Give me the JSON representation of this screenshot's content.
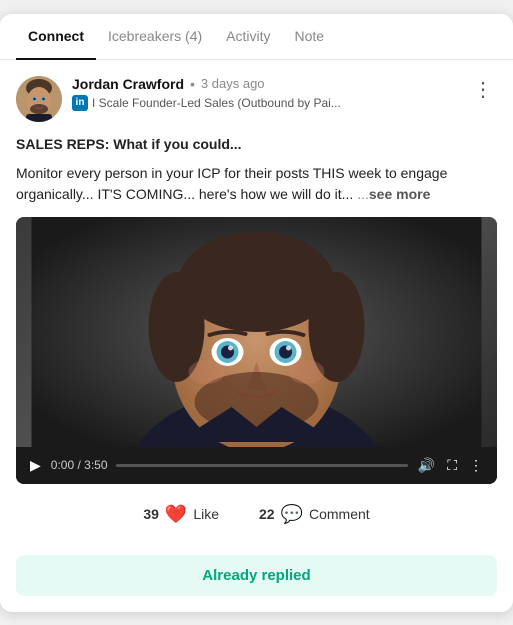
{
  "tabs": [
    {
      "id": "connect",
      "label": "Connect",
      "active": true
    },
    {
      "id": "icebreakers",
      "label": "Icebreakers (4)",
      "active": false
    },
    {
      "id": "activity",
      "label": "Activity",
      "active": false
    },
    {
      "id": "note",
      "label": "Note",
      "active": false
    }
  ],
  "post": {
    "author": {
      "name": "Jordan Crawford",
      "time_ago": "3 days ago",
      "linkedin_icon": "in",
      "subtitle": "I Scale Founder-Led Sales (Outbound by Pai..."
    },
    "headline": "SALES REPS: What if you could...",
    "body": "Monitor every person in your ICP for their posts THIS week to engage organically... IT'S COMING... here's how we will do it...",
    "see_more_prefix": "   ...",
    "see_more_label": "see more",
    "video": {
      "time_current": "0:00",
      "time_total": "3:50",
      "progress_pct": 0
    },
    "likes_count": "39",
    "likes_label": "Like",
    "likes_emoji": "❤️",
    "comments_count": "22",
    "comments_label": "Comment",
    "comments_emoji": "💬",
    "reply_button_label": "Already replied"
  },
  "icons": {
    "more": "⋮",
    "play": "▶",
    "volume": "🔊",
    "fullscreen": "⛶",
    "options": "⋮"
  }
}
